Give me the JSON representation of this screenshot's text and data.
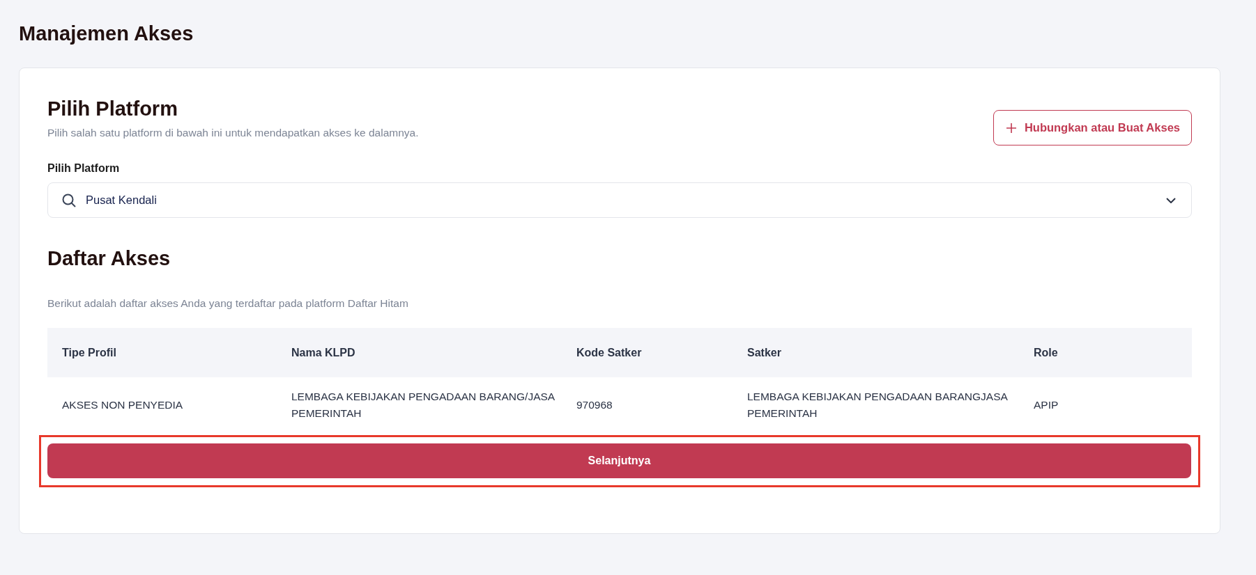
{
  "page_title": "Manajemen Akses",
  "platform_section": {
    "title": "Pilih Platform",
    "subtitle": "Pilih salah satu platform di bawah ini untuk mendapatkan akses ke dalamnya.",
    "action_button": "Hubungkan atau Buat Akses",
    "field_label": "Pilih Platform",
    "select_value": "Pusat Kendali"
  },
  "access_section": {
    "title": "Daftar Akses",
    "subtitle": "Berikut adalah daftar akses Anda yang terdaftar pada platform Daftar Hitam"
  },
  "table": {
    "columns": [
      "Tipe Profil",
      "Nama KLPD",
      "Kode Satker",
      "Satker",
      "Role"
    ],
    "rows": [
      {
        "cells": [
          "AKSES NON PENYEDIA",
          "LEMBAGA KEBIJAKAN PENGADAAN BARANG/JASA PEMERINTAH",
          "970968",
          "LEMBAGA KEBIJAKAN PENGADAAN BARANGJASA PEMERINTAH",
          "APIP"
        ]
      }
    ]
  },
  "next_button": "Selanjutnya"
}
